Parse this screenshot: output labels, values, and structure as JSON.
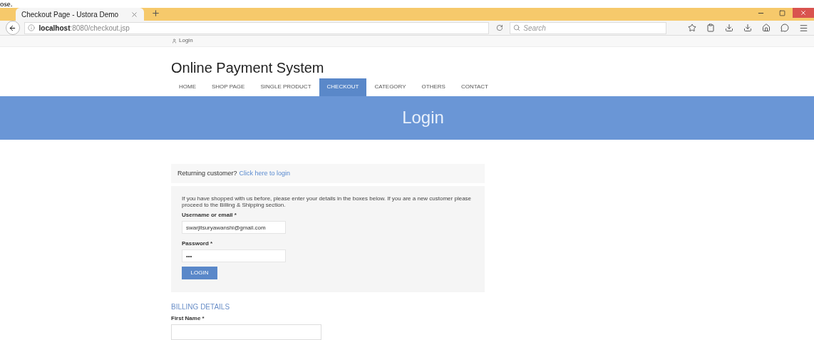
{
  "document_fragment": "ose.",
  "browser": {
    "tab": {
      "title": "Checkout Page - Ustora Demo",
      "selected": true
    },
    "address": {
      "host": "localhost",
      "path": ":8080/checkout.jsp"
    },
    "search": {
      "placeholder": "Search"
    }
  },
  "top_bar": {
    "link": "Login"
  },
  "site_title": "Online Payment System",
  "nav": [
    {
      "label": "HOME",
      "selected": false
    },
    {
      "label": "SHOP PAGE",
      "selected": false
    },
    {
      "label": "SINGLE PRODUCT",
      "selected": false
    },
    {
      "label": "CHECKOUT",
      "selected": true
    },
    {
      "label": "CATEGORY",
      "selected": false
    },
    {
      "label": "OTHERS",
      "selected": false
    },
    {
      "label": "CONTACT",
      "selected": false
    }
  ],
  "banner": "Login",
  "returning": {
    "text": "Returning customer?",
    "link": "Click here to login"
  },
  "login_form": {
    "intro": "If you have shopped with us before, please enter your details in the boxes below. If you are a new customer please proceed to the Billing & Shipping section.",
    "fields": [
      {
        "label": "Username or email *",
        "value": "swarjitsuryawanshi@gmail.com"
      },
      {
        "label": "Password *",
        "value": "•••"
      }
    ],
    "button": "LOGIN"
  },
  "billing": {
    "heading": "BILLING DETAILS",
    "fields": [
      {
        "label": "First Name *"
      }
    ]
  }
}
